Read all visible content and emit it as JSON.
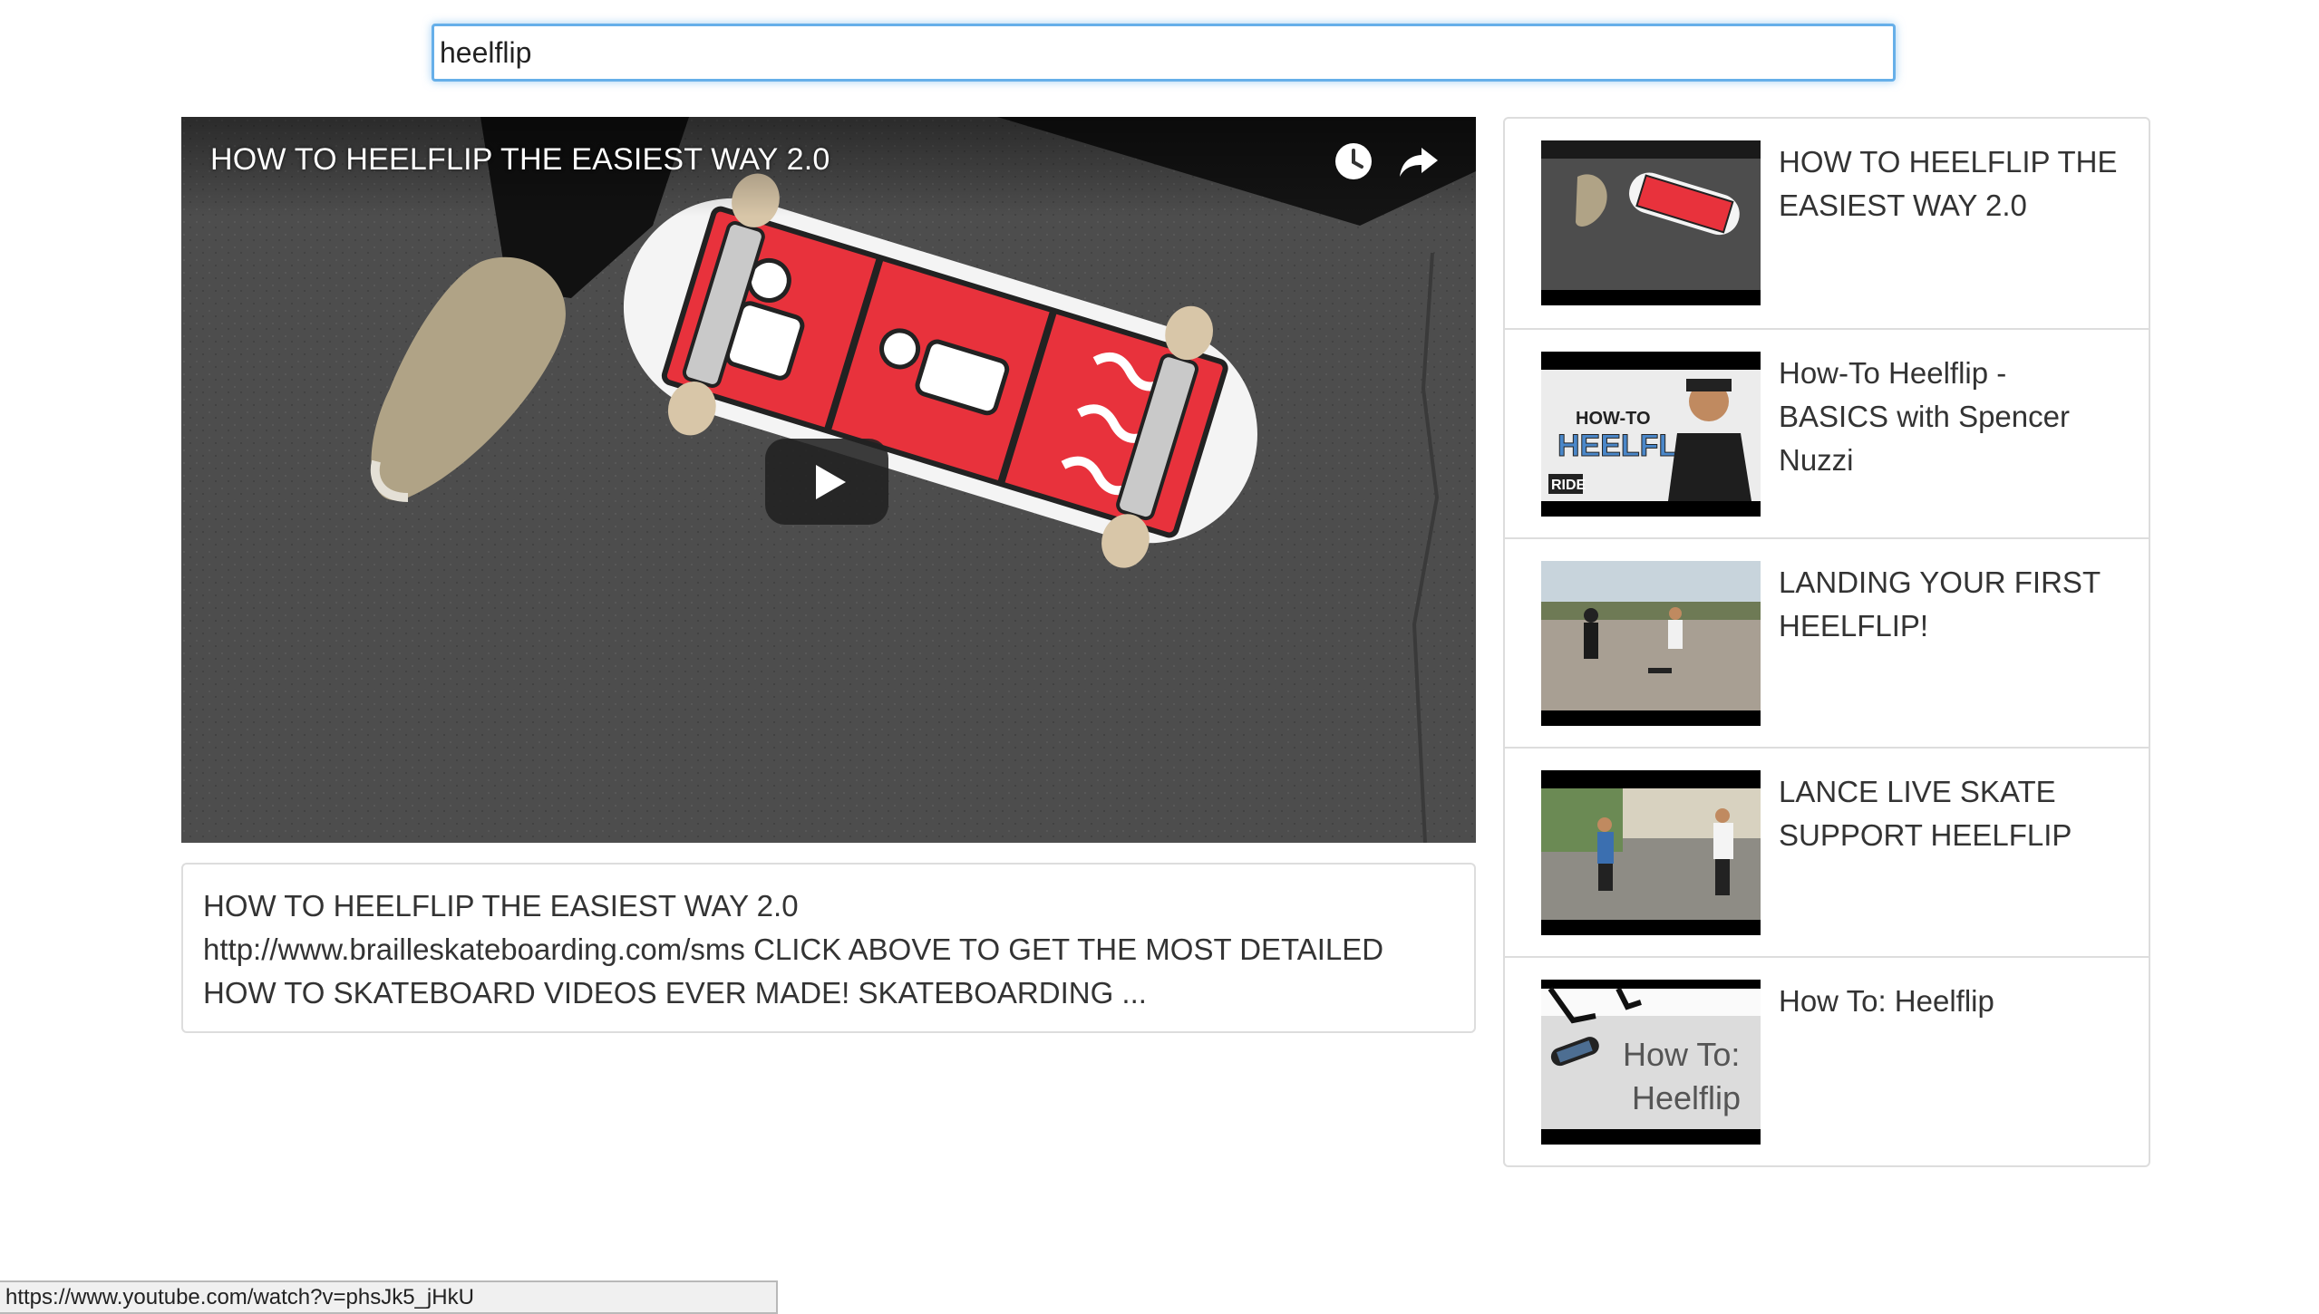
{
  "search": {
    "value": "heelflip"
  },
  "player": {
    "title": "HOW TO HEELFLIP THE EASIEST WAY 2.0",
    "icons": [
      "watch-later-icon",
      "share-icon",
      "play-icon"
    ]
  },
  "description": {
    "title": "HOW TO HEELFLIP THE EASIEST WAY 2.0",
    "body": "http://www.brailleskateboarding.com/sms CLICK ABOVE TO GET THE MOST DETAILED HOW TO SKATEBOARD VIDEOS EVER MADE! SKATEBOARDING ..."
  },
  "results": [
    {
      "title": "HOW TO HEELFLIP THE EASIEST WAY 2.0"
    },
    {
      "title": "How-To Heelflip - BASICS with Spencer Nuzzi",
      "thumb_text": [
        "HOW-TO",
        "HEELFLIP",
        "RIDE"
      ]
    },
    {
      "title": "LANDING YOUR FIRST HEELFLIP!"
    },
    {
      "title": "LANCE LIVE SKATE SUPPORT HEELFLIP"
    },
    {
      "title": "How To: Heelflip",
      "thumb_text": [
        "How To:",
        "Heelflip"
      ]
    }
  ],
  "status_bar": {
    "url": "https://www.youtube.com/watch?v=phsJk5_jHkU"
  },
  "colors": {
    "focus_border": "#66afe9",
    "deck_red": "#e8323c",
    "panel_border": "#dddddd"
  }
}
